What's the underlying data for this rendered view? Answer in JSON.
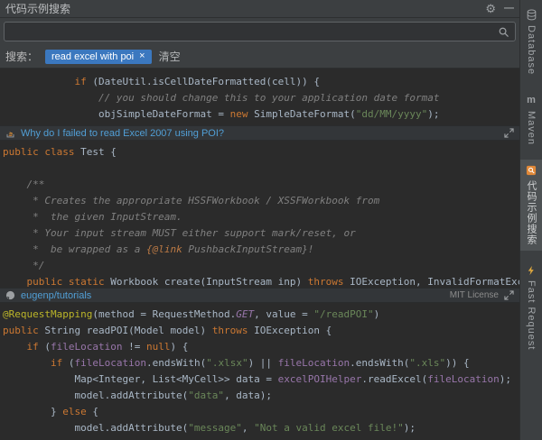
{
  "titlebar": {
    "title": "代码示例搜索",
    "gear_icon": "⚙",
    "hide_icon": "—"
  },
  "search": {
    "input_value": "",
    "history_label": "搜索：",
    "term": "read excel with poi",
    "chip_close": "×",
    "clear_label": "清空"
  },
  "results": [
    {
      "title": "",
      "lines": [
        [
          [
            "p",
            "            "
          ],
          [
            "k",
            "if"
          ],
          [
            "p",
            " (DateUtil.isCellDateFormatted(cell)) {"
          ]
        ],
        [
          [
            "c",
            "                // you should change this to your application date format"
          ]
        ],
        [
          [
            "p",
            "                objSimpleDateFormat = "
          ],
          [
            "k",
            "new"
          ],
          [
            "p",
            " SimpleDateFormat("
          ],
          [
            "s",
            "\"dd/MM/yyyy\""
          ],
          [
            "p",
            ");"
          ]
        ]
      ]
    },
    {
      "title": "Why do I failed to read Excel 2007 using POI?",
      "lines": [
        [
          [
            "k",
            "public class"
          ],
          [
            "p",
            " Test {"
          ]
        ],
        [
          [
            "p",
            ""
          ]
        ],
        [
          [
            "c",
            "    /**"
          ]
        ],
        [
          [
            "c",
            "     * Creates the appropriate HSSFWorkbook / XSSFWorkbook from"
          ]
        ],
        [
          [
            "c",
            "     *  the given InputStream."
          ]
        ],
        [
          [
            "c",
            "     * Your input stream MUST either support mark/reset, or"
          ]
        ],
        [
          [
            "c",
            "     *  be wrapped as a "
          ],
          [
            "t",
            "{@link"
          ],
          [
            "c",
            " PushbackInputStream}!"
          ]
        ],
        [
          [
            "c",
            "     */"
          ]
        ],
        [
          [
            "p",
            "    "
          ],
          [
            "k",
            "public static"
          ],
          [
            "p",
            " Workbook create(InputStream inp) "
          ],
          [
            "k",
            "throws"
          ],
          [
            "p",
            " IOException, InvalidFormatExce"
          ]
        ]
      ]
    },
    {
      "title": "eugenp/tutorials",
      "license": "MIT License",
      "lines": [
        [
          [
            "a",
            "@RequestMapping"
          ],
          [
            "p",
            "(method = RequestMethod."
          ],
          [
            "g",
            "GET"
          ],
          [
            "p",
            ", value = "
          ],
          [
            "s",
            "\"/readPOI\""
          ],
          [
            "p",
            ")"
          ]
        ],
        [
          [
            "k",
            "public"
          ],
          [
            "p",
            " String readPOI(Model model) "
          ],
          [
            "k",
            "throws"
          ],
          [
            "p",
            " IOException {"
          ]
        ],
        [
          [
            "p",
            "    "
          ],
          [
            "k",
            "if"
          ],
          [
            "p",
            " ("
          ],
          [
            "f",
            "fileLocation"
          ],
          [
            "p",
            " != "
          ],
          [
            "k",
            "null"
          ],
          [
            "p",
            ") {"
          ]
        ],
        [
          [
            "p",
            "        "
          ],
          [
            "k",
            "if"
          ],
          [
            "p",
            " ("
          ],
          [
            "f",
            "fileLocation"
          ],
          [
            "p",
            ".endsWith("
          ],
          [
            "s",
            "\".xlsx\""
          ],
          [
            "p",
            ") || "
          ],
          [
            "f",
            "fileLocation"
          ],
          [
            "p",
            ".endsWith("
          ],
          [
            "s",
            "\".xls\""
          ],
          [
            "p",
            ")) {"
          ]
        ],
        [
          [
            "p",
            "            Map<Integer, List<MyCell>> data = "
          ],
          [
            "f",
            "excelPOIHelper"
          ],
          [
            "p",
            ".readExcel("
          ],
          [
            "f",
            "fileLocation"
          ],
          [
            "p",
            ");"
          ]
        ],
        [
          [
            "p",
            "            model.addAttribute("
          ],
          [
            "s",
            "\"data\""
          ],
          [
            "p",
            ", data);"
          ]
        ],
        [
          [
            "p",
            "        } "
          ],
          [
            "k",
            "else"
          ],
          [
            "p",
            " {"
          ]
        ],
        [
          [
            "p",
            "            model.addAttribute("
          ],
          [
            "s",
            "\"message\""
          ],
          [
            "p",
            ", "
          ],
          [
            "s",
            "\"Not a valid excel file!\""
          ],
          [
            "p",
            ");"
          ]
        ]
      ]
    }
  ],
  "stripe": {
    "items": [
      {
        "label": "Database",
        "icon": "database-icon",
        "selected": false
      },
      {
        "label": "Maven",
        "icon": "maven-icon",
        "icon_glyph": "m",
        "selected": false
      },
      {
        "label": "代码示例搜索",
        "icon": "code-search-plugin-icon",
        "selected": true
      },
      {
        "label": "Fast Request",
        "icon": "fast-request-icon",
        "selected": false
      }
    ]
  },
  "colors": {
    "panel_bg": "#3c3f41",
    "editor_bg": "#2b2b2b",
    "keyword": "#cc7832",
    "string": "#6a8759",
    "comment": "#808080",
    "annotation": "#bbb529",
    "field_purple": "#9876aa",
    "link_blue": "#519fd6",
    "chip_blue": "#3b78bf"
  }
}
